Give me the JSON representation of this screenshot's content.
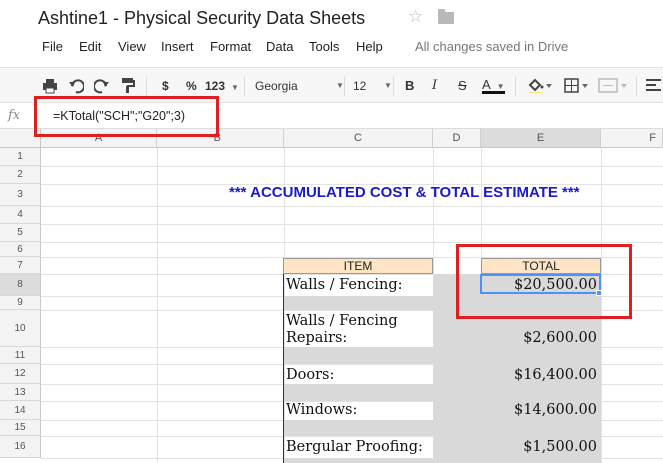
{
  "doc": {
    "title": "Ashtine1 - Physical Security Data Sheets",
    "saved_status": "All changes saved in Drive"
  },
  "menu": [
    "File",
    "Edit",
    "View",
    "Insert",
    "Format",
    "Data",
    "Tools",
    "Help"
  ],
  "toolbar": {
    "currency": "$",
    "percent": "%",
    "number_format": "123",
    "font": "Georgia",
    "font_size": "12",
    "bold": "B",
    "italic": "I",
    "strike": "S",
    "text_color": "A"
  },
  "formula_bar": {
    "fx": "fx",
    "formula": "=KTotal(\"SCH\";\"G20\";3)"
  },
  "columns": [
    "A",
    "B",
    "C",
    "D",
    "E",
    "F"
  ],
  "rows": [
    "1",
    "2",
    "3",
    "4",
    "5",
    "6",
    "7",
    "8",
    "9",
    "10",
    "11",
    "12",
    "13",
    "14",
    "15",
    "16"
  ],
  "sheet": {
    "banner": "*** ACCUMULATED COST & TOTAL ESTIMATE ***",
    "header_item": "ITEM",
    "header_total": "TOTAL",
    "items": [
      {
        "label": "Walls / Fencing:",
        "total": "$20,500.00"
      },
      {
        "label": "Walls / Fencing",
        "label2": "Repairs:",
        "total": "$2,600.00"
      },
      {
        "label": "Doors:",
        "total": "$16,400.00"
      },
      {
        "label": "Windows:",
        "total": "$14,600.00"
      },
      {
        "label": "Bergular Proofing:",
        "total": "$1,500.00"
      }
    ]
  },
  "colors": {
    "banner": "#1a1acc",
    "highlight_box": "#e02020",
    "header_fill": "#fce4c4",
    "grey_fill": "#d9d9d9",
    "selection": "#4d90fe"
  }
}
